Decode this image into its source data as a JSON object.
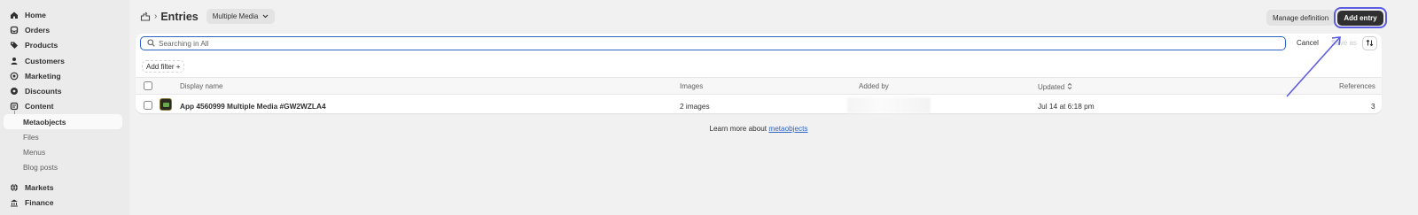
{
  "sidebar": {
    "items": [
      {
        "label": "Home",
        "icon": "home-icon"
      },
      {
        "label": "Orders",
        "icon": "orders-icon"
      },
      {
        "label": "Products",
        "icon": "tag-icon"
      },
      {
        "label": "Customers",
        "icon": "person-icon"
      },
      {
        "label": "Marketing",
        "icon": "target-icon"
      },
      {
        "label": "Discounts",
        "icon": "gear-badge-icon"
      },
      {
        "label": "Content",
        "icon": "content-icon"
      }
    ],
    "content_sub": [
      {
        "label": "Metaobjects",
        "active": true
      },
      {
        "label": "Files"
      },
      {
        "label": "Menus"
      },
      {
        "label": "Blog posts"
      }
    ],
    "bottom_items": [
      {
        "label": "Markets",
        "icon": "globe-icon"
      },
      {
        "label": "Finance",
        "icon": "bank-icon"
      }
    ]
  },
  "header": {
    "title": "Entries",
    "definition_selector": "Multiple Media",
    "manage_definition_label": "Manage definition",
    "add_entry_label": "Add entry"
  },
  "search": {
    "placeholder": "Searching in All",
    "cancel_label": "Cancel",
    "save_as_label": "Save as"
  },
  "filters": {
    "add_filter_label": "Add filter +"
  },
  "table": {
    "columns": [
      "Display name",
      "Images",
      "Added by",
      "Updated",
      "References"
    ],
    "rows": [
      {
        "display_name": "App 4560999 Multiple Media #GW2WZLA4",
        "images": "2 images",
        "added_by": "",
        "updated": "Jul 14 at 6:18 pm",
        "references": "3"
      }
    ]
  },
  "footer": {
    "text": "Learn more about",
    "link": "metaobjects"
  },
  "colors": {
    "accent": "#2e63c3",
    "highlight_ring": "#5b5ce2",
    "primary_button": "#303030"
  }
}
